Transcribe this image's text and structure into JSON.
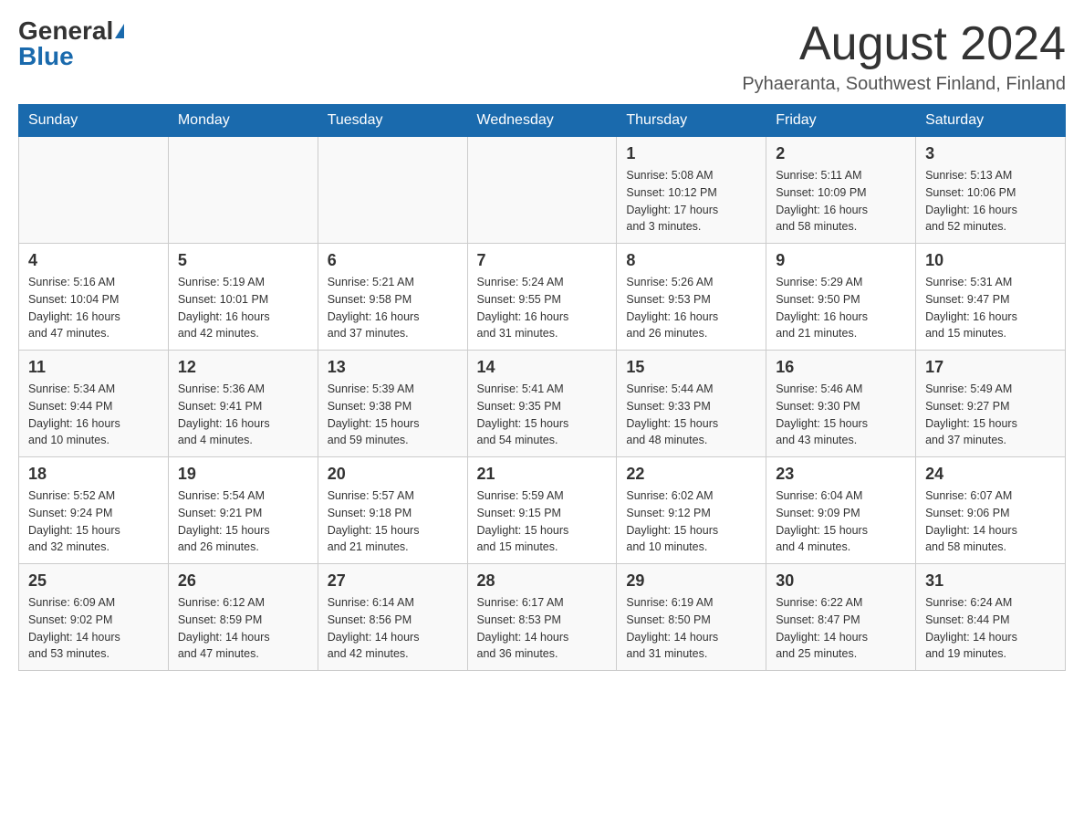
{
  "header": {
    "logo_general": "General",
    "logo_blue": "Blue",
    "month_title": "August 2024",
    "location": "Pyhaeranta, Southwest Finland, Finland"
  },
  "days_of_week": [
    "Sunday",
    "Monday",
    "Tuesday",
    "Wednesday",
    "Thursday",
    "Friday",
    "Saturday"
  ],
  "weeks": [
    [
      {
        "day": "",
        "info": ""
      },
      {
        "day": "",
        "info": ""
      },
      {
        "day": "",
        "info": ""
      },
      {
        "day": "",
        "info": ""
      },
      {
        "day": "1",
        "info": "Sunrise: 5:08 AM\nSunset: 10:12 PM\nDaylight: 17 hours\nand 3 minutes."
      },
      {
        "day": "2",
        "info": "Sunrise: 5:11 AM\nSunset: 10:09 PM\nDaylight: 16 hours\nand 58 minutes."
      },
      {
        "day": "3",
        "info": "Sunrise: 5:13 AM\nSunset: 10:06 PM\nDaylight: 16 hours\nand 52 minutes."
      }
    ],
    [
      {
        "day": "4",
        "info": "Sunrise: 5:16 AM\nSunset: 10:04 PM\nDaylight: 16 hours\nand 47 minutes."
      },
      {
        "day": "5",
        "info": "Sunrise: 5:19 AM\nSunset: 10:01 PM\nDaylight: 16 hours\nand 42 minutes."
      },
      {
        "day": "6",
        "info": "Sunrise: 5:21 AM\nSunset: 9:58 PM\nDaylight: 16 hours\nand 37 minutes."
      },
      {
        "day": "7",
        "info": "Sunrise: 5:24 AM\nSunset: 9:55 PM\nDaylight: 16 hours\nand 31 minutes."
      },
      {
        "day": "8",
        "info": "Sunrise: 5:26 AM\nSunset: 9:53 PM\nDaylight: 16 hours\nand 26 minutes."
      },
      {
        "day": "9",
        "info": "Sunrise: 5:29 AM\nSunset: 9:50 PM\nDaylight: 16 hours\nand 21 minutes."
      },
      {
        "day": "10",
        "info": "Sunrise: 5:31 AM\nSunset: 9:47 PM\nDaylight: 16 hours\nand 15 minutes."
      }
    ],
    [
      {
        "day": "11",
        "info": "Sunrise: 5:34 AM\nSunset: 9:44 PM\nDaylight: 16 hours\nand 10 minutes."
      },
      {
        "day": "12",
        "info": "Sunrise: 5:36 AM\nSunset: 9:41 PM\nDaylight: 16 hours\nand 4 minutes."
      },
      {
        "day": "13",
        "info": "Sunrise: 5:39 AM\nSunset: 9:38 PM\nDaylight: 15 hours\nand 59 minutes."
      },
      {
        "day": "14",
        "info": "Sunrise: 5:41 AM\nSunset: 9:35 PM\nDaylight: 15 hours\nand 54 minutes."
      },
      {
        "day": "15",
        "info": "Sunrise: 5:44 AM\nSunset: 9:33 PM\nDaylight: 15 hours\nand 48 minutes."
      },
      {
        "day": "16",
        "info": "Sunrise: 5:46 AM\nSunset: 9:30 PM\nDaylight: 15 hours\nand 43 minutes."
      },
      {
        "day": "17",
        "info": "Sunrise: 5:49 AM\nSunset: 9:27 PM\nDaylight: 15 hours\nand 37 minutes."
      }
    ],
    [
      {
        "day": "18",
        "info": "Sunrise: 5:52 AM\nSunset: 9:24 PM\nDaylight: 15 hours\nand 32 minutes."
      },
      {
        "day": "19",
        "info": "Sunrise: 5:54 AM\nSunset: 9:21 PM\nDaylight: 15 hours\nand 26 minutes."
      },
      {
        "day": "20",
        "info": "Sunrise: 5:57 AM\nSunset: 9:18 PM\nDaylight: 15 hours\nand 21 minutes."
      },
      {
        "day": "21",
        "info": "Sunrise: 5:59 AM\nSunset: 9:15 PM\nDaylight: 15 hours\nand 15 minutes."
      },
      {
        "day": "22",
        "info": "Sunrise: 6:02 AM\nSunset: 9:12 PM\nDaylight: 15 hours\nand 10 minutes."
      },
      {
        "day": "23",
        "info": "Sunrise: 6:04 AM\nSunset: 9:09 PM\nDaylight: 15 hours\nand 4 minutes."
      },
      {
        "day": "24",
        "info": "Sunrise: 6:07 AM\nSunset: 9:06 PM\nDaylight: 14 hours\nand 58 minutes."
      }
    ],
    [
      {
        "day": "25",
        "info": "Sunrise: 6:09 AM\nSunset: 9:02 PM\nDaylight: 14 hours\nand 53 minutes."
      },
      {
        "day": "26",
        "info": "Sunrise: 6:12 AM\nSunset: 8:59 PM\nDaylight: 14 hours\nand 47 minutes."
      },
      {
        "day": "27",
        "info": "Sunrise: 6:14 AM\nSunset: 8:56 PM\nDaylight: 14 hours\nand 42 minutes."
      },
      {
        "day": "28",
        "info": "Sunrise: 6:17 AM\nSunset: 8:53 PM\nDaylight: 14 hours\nand 36 minutes."
      },
      {
        "day": "29",
        "info": "Sunrise: 6:19 AM\nSunset: 8:50 PM\nDaylight: 14 hours\nand 31 minutes."
      },
      {
        "day": "30",
        "info": "Sunrise: 6:22 AM\nSunset: 8:47 PM\nDaylight: 14 hours\nand 25 minutes."
      },
      {
        "day": "31",
        "info": "Sunrise: 6:24 AM\nSunset: 8:44 PM\nDaylight: 14 hours\nand 19 minutes."
      }
    ]
  ]
}
